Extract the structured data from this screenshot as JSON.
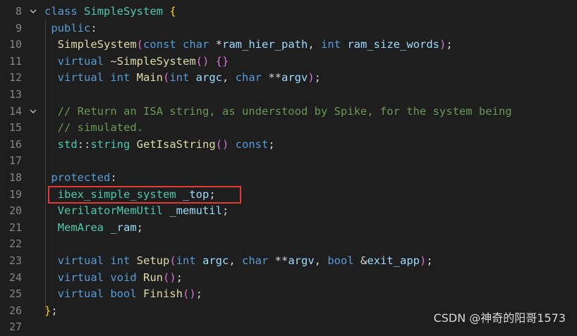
{
  "editor": {
    "lines": [
      {
        "num": "8",
        "fold": true,
        "tokens": [
          [
            "k",
            "class "
          ],
          [
            "t",
            "SimpleSystem "
          ],
          [
            "b1",
            "{"
          ]
        ]
      },
      {
        "num": "9",
        "fold": false,
        "tokens": [
          [
            "p",
            " "
          ],
          [
            "k",
            "public"
          ],
          [
            "p",
            ":"
          ]
        ]
      },
      {
        "num": "10",
        "fold": false,
        "tokens": [
          [
            "p",
            "  "
          ],
          [
            "f",
            "SimpleSystem"
          ],
          [
            "b2",
            "("
          ],
          [
            "k",
            "const "
          ],
          [
            "k",
            "char "
          ],
          [
            "o",
            "*"
          ],
          [
            "v",
            "ram_hier_path"
          ],
          [
            "p",
            ", "
          ],
          [
            "k",
            "int "
          ],
          [
            "v",
            "ram_size_words"
          ],
          [
            "b2",
            ")"
          ],
          [
            "p",
            ";"
          ]
        ]
      },
      {
        "num": "11",
        "fold": false,
        "tokens": [
          [
            "p",
            "  "
          ],
          [
            "k",
            "virtual "
          ],
          [
            "p",
            "~"
          ],
          [
            "f",
            "SimpleSystem"
          ],
          [
            "b2",
            "()"
          ],
          [
            "p",
            " "
          ],
          [
            "b2",
            "{}"
          ]
        ]
      },
      {
        "num": "12",
        "fold": false,
        "tokens": [
          [
            "p",
            "  "
          ],
          [
            "k",
            "virtual "
          ],
          [
            "k",
            "int "
          ],
          [
            "f",
            "Main"
          ],
          [
            "b2",
            "("
          ],
          [
            "k",
            "int "
          ],
          [
            "v",
            "argc"
          ],
          [
            "p",
            ", "
          ],
          [
            "k",
            "char "
          ],
          [
            "o",
            "**"
          ],
          [
            "v",
            "argv"
          ],
          [
            "b2",
            ")"
          ],
          [
            "p",
            ";"
          ]
        ]
      },
      {
        "num": "13",
        "fold": false,
        "tokens": []
      },
      {
        "num": "14",
        "fold": true,
        "tokens": [
          [
            "p",
            "  "
          ],
          [
            "c",
            "// Return an ISA string, as understood by Spike, for the system being"
          ]
        ]
      },
      {
        "num": "15",
        "fold": false,
        "tokens": [
          [
            "p",
            "  "
          ],
          [
            "c",
            "// simulated."
          ]
        ]
      },
      {
        "num": "16",
        "fold": false,
        "tokens": [
          [
            "p",
            "  "
          ],
          [
            "t",
            "std"
          ],
          [
            "p",
            "::"
          ],
          [
            "t",
            "string "
          ],
          [
            "f",
            "GetIsaString"
          ],
          [
            "b2",
            "()"
          ],
          [
            "p",
            " "
          ],
          [
            "k",
            "const"
          ],
          [
            "p",
            ";"
          ]
        ]
      },
      {
        "num": "17",
        "fold": false,
        "tokens": []
      },
      {
        "num": "18",
        "fold": false,
        "tokens": [
          [
            "p",
            " "
          ],
          [
            "k",
            "protected"
          ],
          [
            "p",
            ":"
          ]
        ]
      },
      {
        "num": "19",
        "fold": false,
        "tokens": [
          [
            "p",
            "  "
          ],
          [
            "t",
            "ibex_simple_system "
          ],
          [
            "v",
            "_top"
          ],
          [
            "p",
            ";"
          ]
        ]
      },
      {
        "num": "20",
        "fold": false,
        "tokens": [
          [
            "p",
            "  "
          ],
          [
            "t",
            "VerilatorMemUtil "
          ],
          [
            "v",
            "_memutil"
          ],
          [
            "p",
            ";"
          ]
        ]
      },
      {
        "num": "21",
        "fold": false,
        "tokens": [
          [
            "p",
            "  "
          ],
          [
            "t",
            "MemArea "
          ],
          [
            "v",
            "_ram"
          ],
          [
            "p",
            ";"
          ]
        ]
      },
      {
        "num": "22",
        "fold": false,
        "tokens": []
      },
      {
        "num": "23",
        "fold": false,
        "tokens": [
          [
            "p",
            "  "
          ],
          [
            "k",
            "virtual "
          ],
          [
            "k",
            "int "
          ],
          [
            "f",
            "Setup"
          ],
          [
            "b2",
            "("
          ],
          [
            "k",
            "int "
          ],
          [
            "v",
            "argc"
          ],
          [
            "p",
            ", "
          ],
          [
            "k",
            "char "
          ],
          [
            "o",
            "**"
          ],
          [
            "v",
            "argv"
          ],
          [
            "p",
            ", "
          ],
          [
            "k",
            "bool "
          ],
          [
            "o",
            "&"
          ],
          [
            "v",
            "exit_app"
          ],
          [
            "b2",
            ")"
          ],
          [
            "p",
            ";"
          ]
        ]
      },
      {
        "num": "24",
        "fold": false,
        "tokens": [
          [
            "p",
            "  "
          ],
          [
            "k",
            "virtual "
          ],
          [
            "k",
            "void "
          ],
          [
            "f",
            "Run"
          ],
          [
            "b2",
            "()"
          ],
          [
            "p",
            ";"
          ]
        ]
      },
      {
        "num": "25",
        "fold": false,
        "tokens": [
          [
            "p",
            "  "
          ],
          [
            "k",
            "virtual "
          ],
          [
            "k",
            "bool "
          ],
          [
            "f",
            "Finish"
          ],
          [
            "b2",
            "()"
          ],
          [
            "p",
            ";"
          ]
        ]
      },
      {
        "num": "26",
        "fold": false,
        "tokens": [
          [
            "b1",
            "}"
          ],
          [
            "p",
            ";"
          ]
        ]
      },
      {
        "num": "27",
        "fold": false,
        "tokens": []
      }
    ]
  },
  "watermark": "CSDN @神奇的阳哥1573",
  "colors": {
    "background": "#1e1e1e",
    "highlight_border": "#e53935"
  }
}
